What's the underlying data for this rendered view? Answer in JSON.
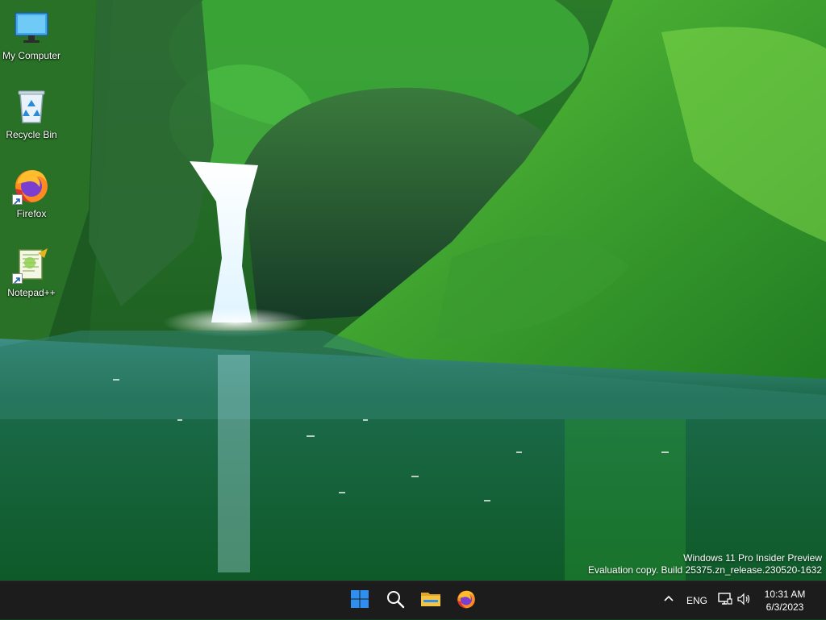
{
  "desktop": {
    "icons": [
      {
        "label": "My Computer",
        "icon": "monitor-icon"
      },
      {
        "label": "Recycle Bin",
        "icon": "recycle-bin-icon"
      },
      {
        "label": "Firefox",
        "icon": "firefox-icon",
        "shortcut": true
      },
      {
        "label": "Notepad++",
        "icon": "notepadpp-icon",
        "shortcut": true
      }
    ],
    "watermark": {
      "line1": "Windows 11 Pro Insider Preview",
      "line2": "Evaluation copy. Build 25375.zn_release.230520-1632"
    }
  },
  "taskbar": {
    "pinned": [
      {
        "name": "start",
        "icon": "windows-logo-icon"
      },
      {
        "name": "search",
        "icon": "search-icon"
      },
      {
        "name": "file-explorer",
        "icon": "folder-icon"
      },
      {
        "name": "firefox",
        "icon": "firefox-icon"
      }
    ],
    "tray": {
      "overflow_icon": "chevron-up-icon",
      "language": "ENG",
      "network_icon": "network-icon",
      "volume_icon": "speaker-icon",
      "time": "10:31 AM",
      "date": "6/3/2023"
    }
  },
  "colors": {
    "taskbar_bg": "#1c1c1c",
    "windows_blue": "#2f8ff0",
    "folder_yellow": "#f5c542"
  }
}
